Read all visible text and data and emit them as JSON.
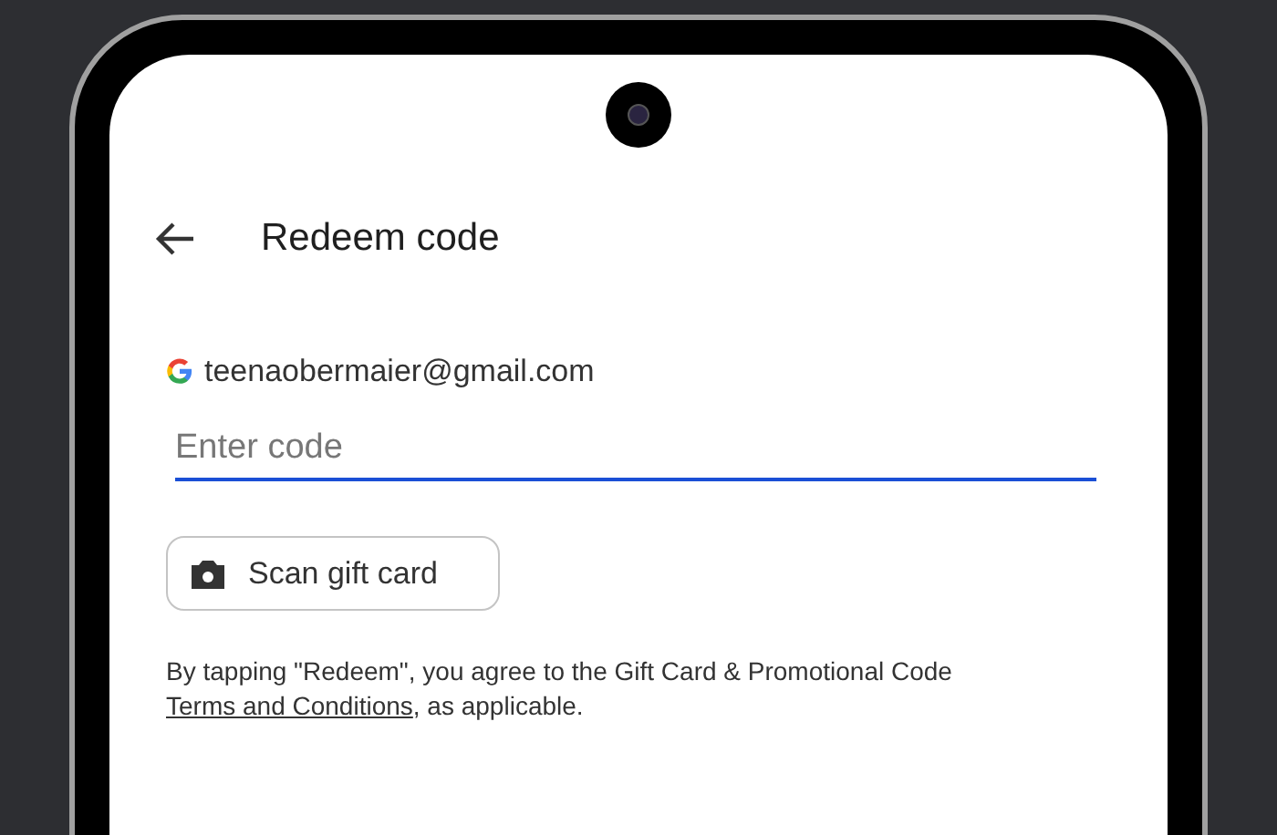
{
  "header": {
    "title": "Redeem code"
  },
  "account": {
    "email": "teenaobermaier@gmail.com"
  },
  "code_field": {
    "placeholder": "Enter code"
  },
  "scan_button": {
    "label": "Scan gift card"
  },
  "disclaimer": {
    "before": "By tapping \"Redeem\", you agree to the Gift Card & Promotional Code ",
    "link": "Terms and Conditions",
    "after": ", as applicable."
  }
}
